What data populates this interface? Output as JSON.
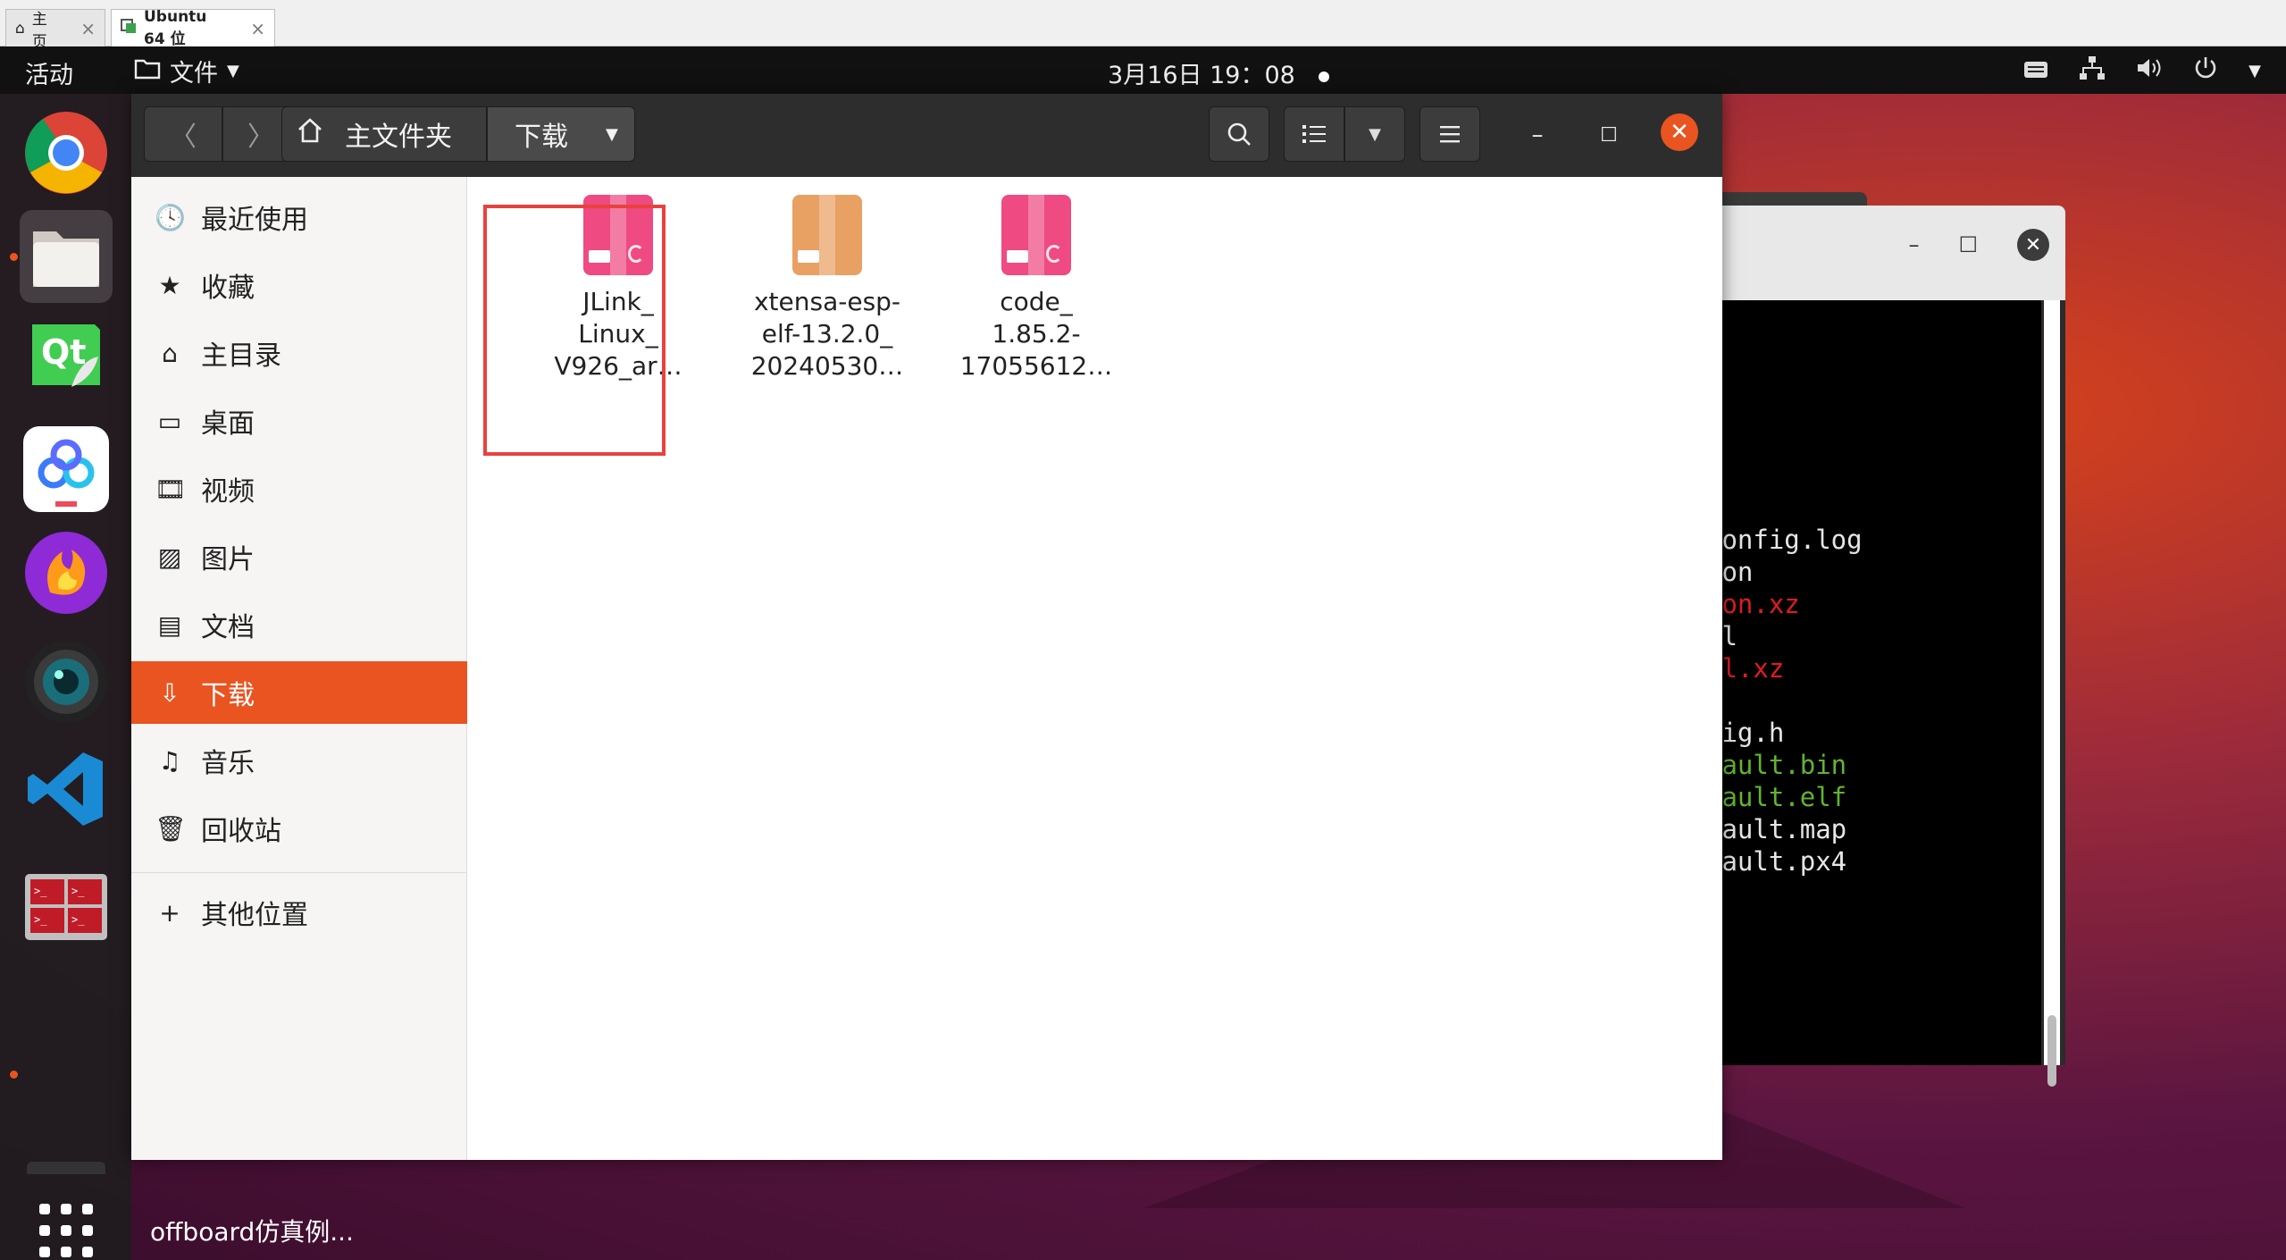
{
  "host": {
    "tabs": [
      {
        "label": "主页",
        "icon": "home-icon"
      },
      {
        "label": "Ubuntu 64 位",
        "icon": "vm-icon"
      }
    ]
  },
  "topbar": {
    "activities": "活动",
    "app_menu": "文件",
    "clock": "3月16日  19：08"
  },
  "dock": {
    "apps": [
      "chrome-icon",
      "files-icon",
      "qt-creator-icon",
      "baidu-netdisk-icon",
      "firefox-dev-icon",
      "camera-icon",
      "vscode-icon",
      "terminator-icon",
      "show-apps-icon"
    ]
  },
  "nautilus": {
    "path": {
      "home": "主文件夹",
      "current": "下载"
    },
    "sidebar": {
      "items": [
        {
          "label": "最近使用",
          "icon": "clock-icon"
        },
        {
          "label": "收藏",
          "icon": "star-icon"
        },
        {
          "label": "主目录",
          "icon": "home-icon"
        },
        {
          "label": "桌面",
          "icon": "desktop-icon"
        },
        {
          "label": "视频",
          "icon": "video-icon"
        },
        {
          "label": "图片",
          "icon": "image-icon"
        },
        {
          "label": "文档",
          "icon": "document-icon"
        },
        {
          "label": "下载",
          "icon": "download-icon"
        },
        {
          "label": "音乐",
          "icon": "music-icon"
        },
        {
          "label": "回收站",
          "icon": "trash-icon"
        },
        {
          "label": "其他位置",
          "icon": "plus-icon"
        }
      ],
      "active_index": 7
    },
    "files": [
      {
        "name_lines": [
          "JLink_",
          "Linux_",
          "V926_ar…"
        ],
        "color": "#ef4a82"
      },
      {
        "name_lines": [
          "xtensa-esp-",
          "elf-13.2.0_",
          "20240530…"
        ],
        "color": "#e9a063"
      },
      {
        "name_lines": [
          "code_",
          "1.85.2-",
          "17055612…"
        ],
        "color": "#ef4a82"
      }
    ]
  },
  "terminal": {
    "lines": [
      {
        "text": "config.log",
        "color": "white"
      },
      {
        "text": "son",
        "color": "white"
      },
      {
        "text": "son.xz",
        "color": "red"
      },
      {
        "text": "ml",
        "color": "white"
      },
      {
        "text": "ml.xz",
        "color": "red"
      },
      {
        "text": "",
        "color": "white"
      },
      {
        "text": "fig.h",
        "color": "white"
      },
      {
        "text": "fault.bin",
        "color": "green"
      },
      {
        "text": "fault.elf",
        "color": "green"
      },
      {
        "text": "fault.map",
        "color": "white"
      },
      {
        "text": "fault.px4",
        "color": "white"
      }
    ]
  },
  "notification": {
    "text": "offboard仿真例..."
  },
  "colors": {
    "accent": "#e95420",
    "highlight": "#e8423f"
  }
}
